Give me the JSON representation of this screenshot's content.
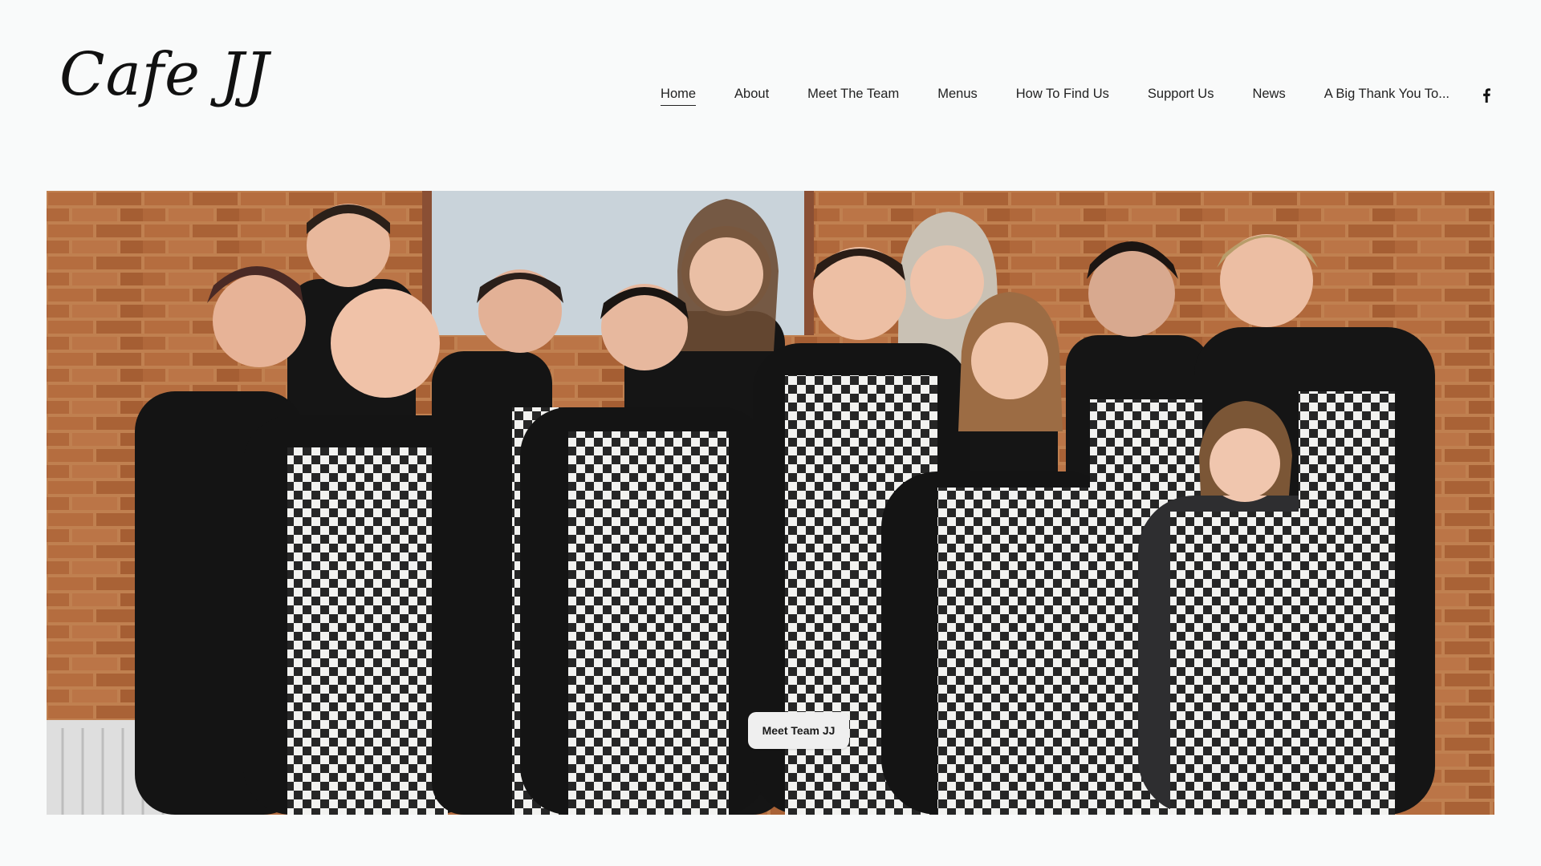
{
  "site": {
    "logo_text": "Cafe JJ"
  },
  "nav": {
    "items": [
      {
        "label": "Home",
        "active": true
      },
      {
        "label": "About"
      },
      {
        "label": "Meet The Team"
      },
      {
        "label": "Menus"
      },
      {
        "label": "How To Find Us"
      },
      {
        "label": "Support Us"
      },
      {
        "label": "News"
      },
      {
        "label": "A Big Thank You To..."
      }
    ],
    "social_icon": "facebook-icon"
  },
  "hero": {
    "cta_label": "Meet Team JJ"
  },
  "colors": {
    "background": "#f9fafa",
    "text": "#222222",
    "button_bg": "#efefef",
    "brick": "#b36a3e"
  }
}
